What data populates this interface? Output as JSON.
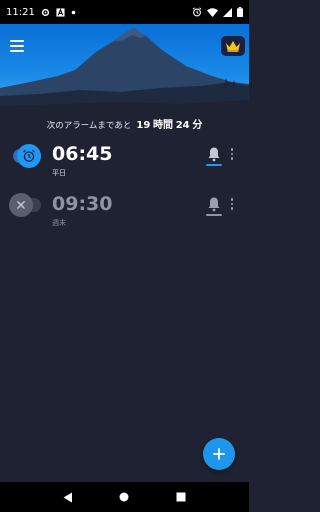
{
  "status_bar": {
    "time": "11:21",
    "icons_left": [
      "settings-icon",
      "font-icon",
      "dot-icon"
    ],
    "icons_right": [
      "alarm-icon",
      "wifi-icon",
      "signal-icon",
      "battery-icon"
    ]
  },
  "header": {
    "menu_icon": "hamburger-icon",
    "premium_icon": "crown-icon",
    "sky_color": "#1a8ae8",
    "premium_color": "#f5c518"
  },
  "next_alarm": {
    "prefix": "次のアラームまであと",
    "hours": "19",
    "hours_unit": "時間",
    "minutes": "24",
    "minutes_unit": "分"
  },
  "alarms": [
    {
      "time": "06:45",
      "label": "平日",
      "enabled": true,
      "icon": "alarm-clock-icon",
      "accent": "#2196f3"
    },
    {
      "time": "09:30",
      "label": "週末",
      "enabled": false,
      "icon": "close-icon",
      "accent": "#5a5e6e"
    }
  ],
  "fab": {
    "icon": "plus-icon"
  },
  "nav": {
    "back": "back-icon",
    "home": "home-icon",
    "recents": "recents-icon"
  }
}
